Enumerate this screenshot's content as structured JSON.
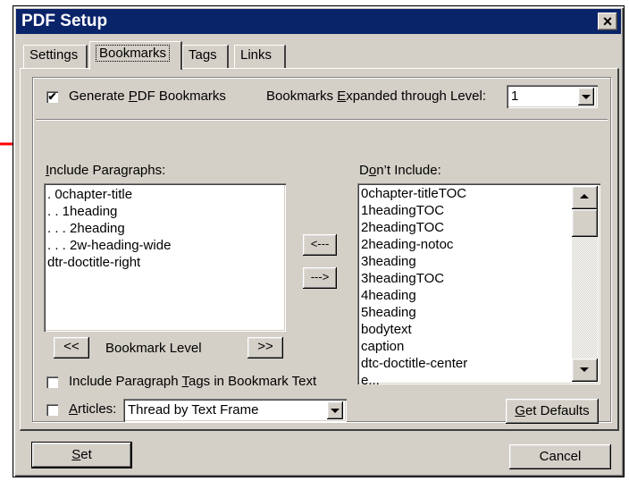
{
  "window": {
    "title": "PDF Setup",
    "close_glyph": "×"
  },
  "tabs": [
    {
      "label": "Settings"
    },
    {
      "label": "Bookmarks"
    },
    {
      "label": "Tags"
    },
    {
      "label": "Links"
    }
  ],
  "generate": {
    "pre": "Generate ",
    "key": "P",
    "post": "DF Bookmarks",
    "checked_glyph": "✔"
  },
  "expanded": {
    "pre": "Bookmarks ",
    "key": "E",
    "post": "xpanded through Level:",
    "value": "1"
  },
  "include": {
    "label_key": "I",
    "label_rest": "nclude Paragraphs:",
    "items": [
      ". 0chapter-title",
      ". . 1heading",
      ". . . 2heading",
      ". . . 2w-heading-wide",
      "dtr-doctitle-right"
    ]
  },
  "exclude": {
    "label_pre": "D",
    "label_key": "o",
    "label_rest": "n’t Include:",
    "items": [
      "0chapter-titleTOC",
      "1headingTOC",
      "2headingTOC",
      "2heading-notoc",
      "3heading",
      "3headingTOC",
      "4heading",
      "5heading",
      "bodytext",
      "caption",
      "dtc-doctitle-center",
      "e..."
    ]
  },
  "move_buttons": {
    "left": "<---",
    "right": "--->"
  },
  "level": {
    "decrease": "<<",
    "label": "Bookmark Level",
    "increase": ">>"
  },
  "include_tags": {
    "pre": "Include Paragraph ",
    "key": "T",
    "post": "ags in Bookmark Text"
  },
  "articles": {
    "key": "A",
    "post": "rticles:",
    "value": "Thread by Text Frame"
  },
  "get_defaults": {
    "key": "G",
    "post": "et Defaults"
  },
  "set_button": {
    "key": "S",
    "post": "et"
  },
  "cancel_button": "Cancel",
  "colors": {
    "title_bar": "#0a246a",
    "dialog_bg": "#d4d0c8",
    "annotation_arrow": "#ff0000"
  },
  "annotation": {
    "icon": "red-arrow-icon"
  }
}
